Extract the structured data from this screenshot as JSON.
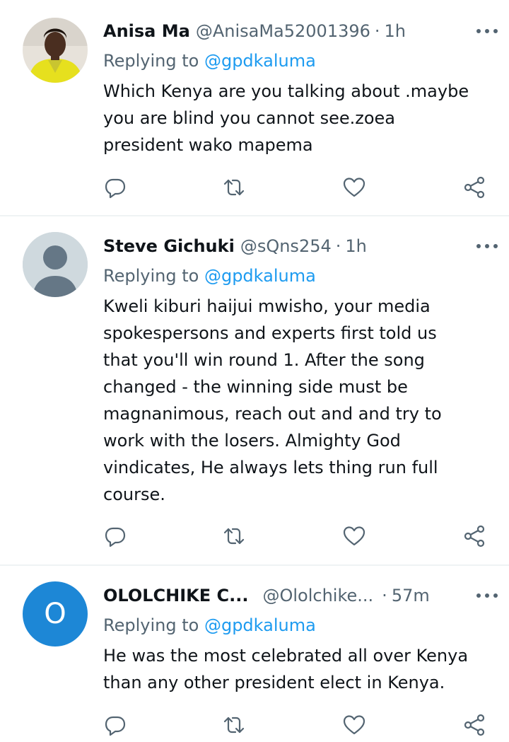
{
  "tweets": [
    {
      "name": "Anisa Ma",
      "handle": "@AnisaMa52001396",
      "time": "1h",
      "replying_prefix": "Replying to",
      "replying_to": "@gpdkaluma",
      "text": "Which Kenya  are you talking about .maybe\nyou are blind you cannot see.zoea\npresident wako mapema",
      "avatar_type": "photo"
    },
    {
      "name": "Steve Gichuki",
      "handle": "@sQns254",
      "time": "1h",
      "replying_prefix": "Replying to",
      "replying_to": "@gpdkaluma",
      "text": "Kweli kiburi haijui mwisho, your media\nspokespersons and experts first told us\nthat you'll win round 1. After the song\nchanged - the winning side must be\nmagnanimous, reach out and and try to\nwork with the losers.  Almighty God\nvindicates, He always lets thing run full\ncourse.",
      "avatar_type": "default"
    },
    {
      "name": "OLOLCHIKE C...",
      "handle": "@Ololchike...",
      "time": "57m",
      "replying_prefix": "Replying to",
      "replying_to": "@gpdkaluma",
      "text": "He was the most celebrated all over Kenya\nthan any other president elect in Kenya.",
      "avatar_type": "letter",
      "avatar_letter": "O"
    }
  ],
  "icons": {
    "reply": "comment-icon",
    "retweet": "retweet-icon",
    "like": "heart-icon",
    "share": "share-icon",
    "more": "more-options-icon"
  },
  "colors": {
    "accent": "#1d9bf0",
    "secondary_text": "#536471",
    "letter_avatar_bg": "#1d87d6"
  }
}
